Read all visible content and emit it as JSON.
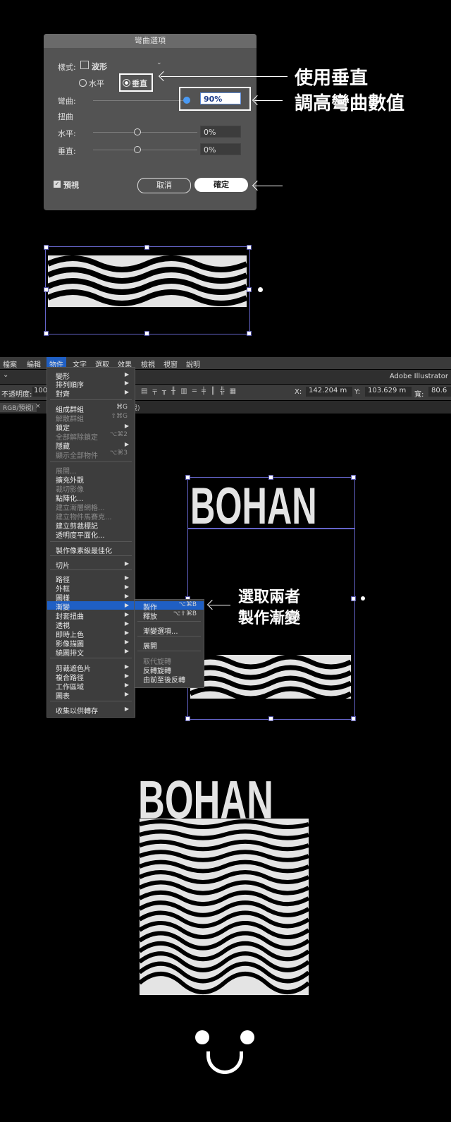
{
  "dialog": {
    "title": "彎曲選項",
    "style_label": "樣式:",
    "style_value": "波形",
    "orientation": {
      "horizontal": "水平",
      "vertical": "垂直",
      "selected": "vertical"
    },
    "bend_label": "彎曲:",
    "bend_value": "90%",
    "distortion_label": "扭曲",
    "horizontal_label": "水平:",
    "horizontal_value": "0%",
    "vertical_label": "垂直:",
    "vertical_value": "0%",
    "preview_label": "預視",
    "cancel_label": "取消",
    "ok_label": "確定"
  },
  "callouts": {
    "use_vertical": "使用垂直",
    "raise_bend": "調高彎曲數值",
    "select_both_1": "選取兩者",
    "select_both_2": "製作漸變"
  },
  "app": {
    "menubar": [
      "檔案",
      "編輯",
      "物件",
      "文字",
      "選取",
      "效果",
      "檢視",
      "視窗",
      "說明"
    ],
    "active_menu": "物件",
    "app_name": "Adobe Illustrator",
    "opacity_label": "不透明度:",
    "opacity_value": "100",
    "x_label": "X:",
    "x_value": "142.204 m",
    "y_label": "Y:",
    "y_value": "103.629 m",
    "w_label": "寬:",
    "w_value": "80.6",
    "tab_text": "RGB/預視)",
    "tab_text2": "視)"
  },
  "object_menu": [
    {
      "label": "變形",
      "arrow": true,
      "y": 0
    },
    {
      "label": "排列順序",
      "arrow": true
    },
    {
      "label": "對齊",
      "arrow": true
    },
    {
      "label": "組成群組",
      "shortcut": "⌘G"
    },
    {
      "label": "解散群組",
      "shortcut": "⇧⌘G",
      "disabled": true
    },
    {
      "label": "鎖定",
      "arrow": true
    },
    {
      "label": "全部解除鎖定",
      "shortcut": "⌥⌘2",
      "disabled": true
    },
    {
      "label": "隱藏",
      "arrow": true
    },
    {
      "label": "顯示全部物件",
      "shortcut": "⌥⌘3",
      "disabled": true
    },
    {
      "label": "展開...",
      "disabled": true
    },
    {
      "label": "擴充外觀"
    },
    {
      "label": "裁切影像",
      "disabled": true
    },
    {
      "label": "點陣化..."
    },
    {
      "label": "建立漸層網格...",
      "disabled": true
    },
    {
      "label": "建立物件馬賽克...",
      "disabled": true
    },
    {
      "label": "建立剪裁標記"
    },
    {
      "label": "透明度平面化..."
    },
    {
      "label": "製作像素級最佳化"
    },
    {
      "label": "切片",
      "arrow": true
    },
    {
      "label": "路徑",
      "arrow": true
    },
    {
      "label": "外框",
      "arrow": true
    },
    {
      "label": "圖樣",
      "arrow": true
    },
    {
      "label": "漸變",
      "arrow": true,
      "highlight": true
    },
    {
      "label": "封套扭曲",
      "arrow": true
    },
    {
      "label": "透視",
      "arrow": true
    },
    {
      "label": "即時上色",
      "arrow": true
    },
    {
      "label": "影像描圖",
      "arrow": true
    },
    {
      "label": "繞圖排文",
      "arrow": true
    },
    {
      "label": "剪裁遮色片",
      "arrow": true
    },
    {
      "label": "複合路徑",
      "arrow": true
    },
    {
      "label": "工作區域",
      "arrow": true
    },
    {
      "label": "圖表",
      "arrow": true
    },
    {
      "label": "收集以供轉存",
      "arrow": true
    }
  ],
  "blend_submenu": [
    {
      "label": "製作",
      "shortcut": "⌥⌘B",
      "highlight": true
    },
    {
      "label": "釋放",
      "shortcut": "⌥⇧⌘B"
    },
    {
      "label": "漸變選項..."
    },
    {
      "label": "展開"
    },
    {
      "label": "取代旋轉",
      "disabled": true
    },
    {
      "label": "反轉旋轉"
    },
    {
      "label": "由前至後反轉"
    }
  ],
  "artwork": {
    "text": "BOHAN"
  },
  "colors": {
    "highlight": "#1f5fc4",
    "selection": "#6464c8",
    "art": "#e4e4e4"
  }
}
